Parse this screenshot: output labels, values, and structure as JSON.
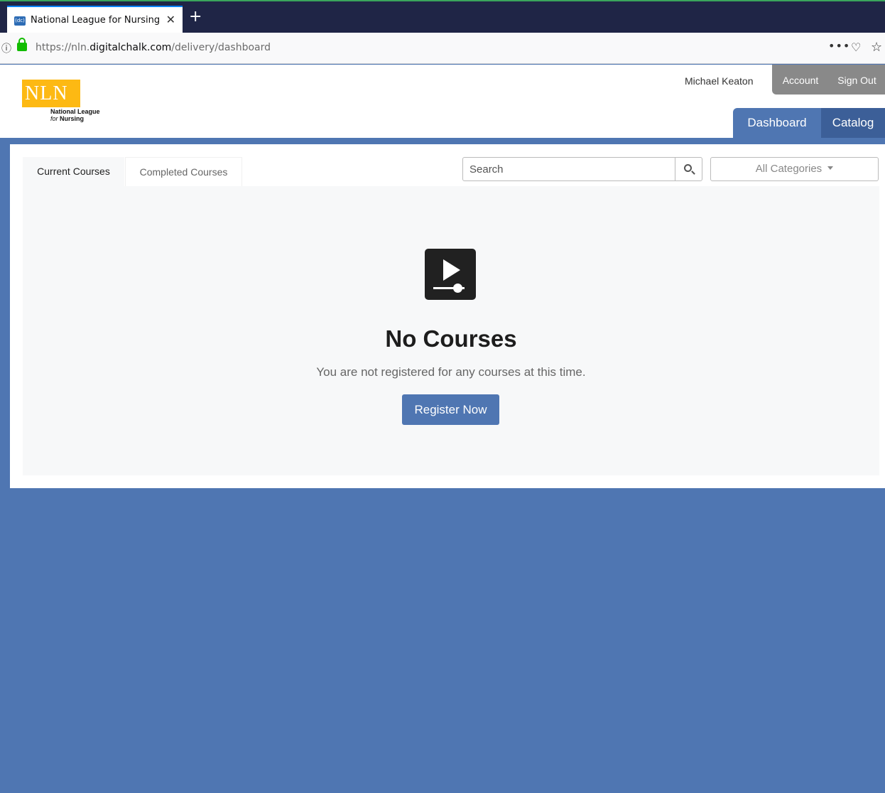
{
  "browser": {
    "tab_title": "National League for Nursing",
    "tab_favicon_text": "(dc)",
    "tab_close": "✕",
    "new_tab": "+",
    "url_info_icon": "ⓘ",
    "url_prefix": "https://nln.",
    "url_host": "digitalchalk.com",
    "url_path": "/delivery/dashboard",
    "more_icon": "•••",
    "pocket_icon": "♡",
    "star_icon": "☆",
    "icons": [
      "info-icon",
      "lock-icon",
      "more-icon",
      "pocket-icon",
      "bookmark-star-icon",
      "close-icon",
      "new-tab-icon"
    ]
  },
  "header": {
    "logo_text": "NLN",
    "logo_line1": "National League",
    "logo_line2_a": "for ",
    "logo_line2_b": "Nursing",
    "user_name": "Michael Keaton",
    "account_label": "Account",
    "signout_label": "Sign Out",
    "nav": {
      "dashboard": "Dashboard",
      "catalog": "Catalog"
    }
  },
  "dashboard": {
    "tabs": {
      "current": "Current Courses",
      "completed": "Completed Courses"
    },
    "search": {
      "placeholder": "Search"
    },
    "categories": {
      "selected": "All Categories"
    },
    "empty": {
      "title": "No Courses",
      "message": "You are not registered for any courses at this time.",
      "button": "Register Now"
    }
  },
  "colors": {
    "brand_blue": "#4f76b2",
    "catalog_blue": "#3c5f98",
    "logo_gold": "#fdb913",
    "header_gray": "#898989",
    "tabbar": "#1f2546"
  }
}
